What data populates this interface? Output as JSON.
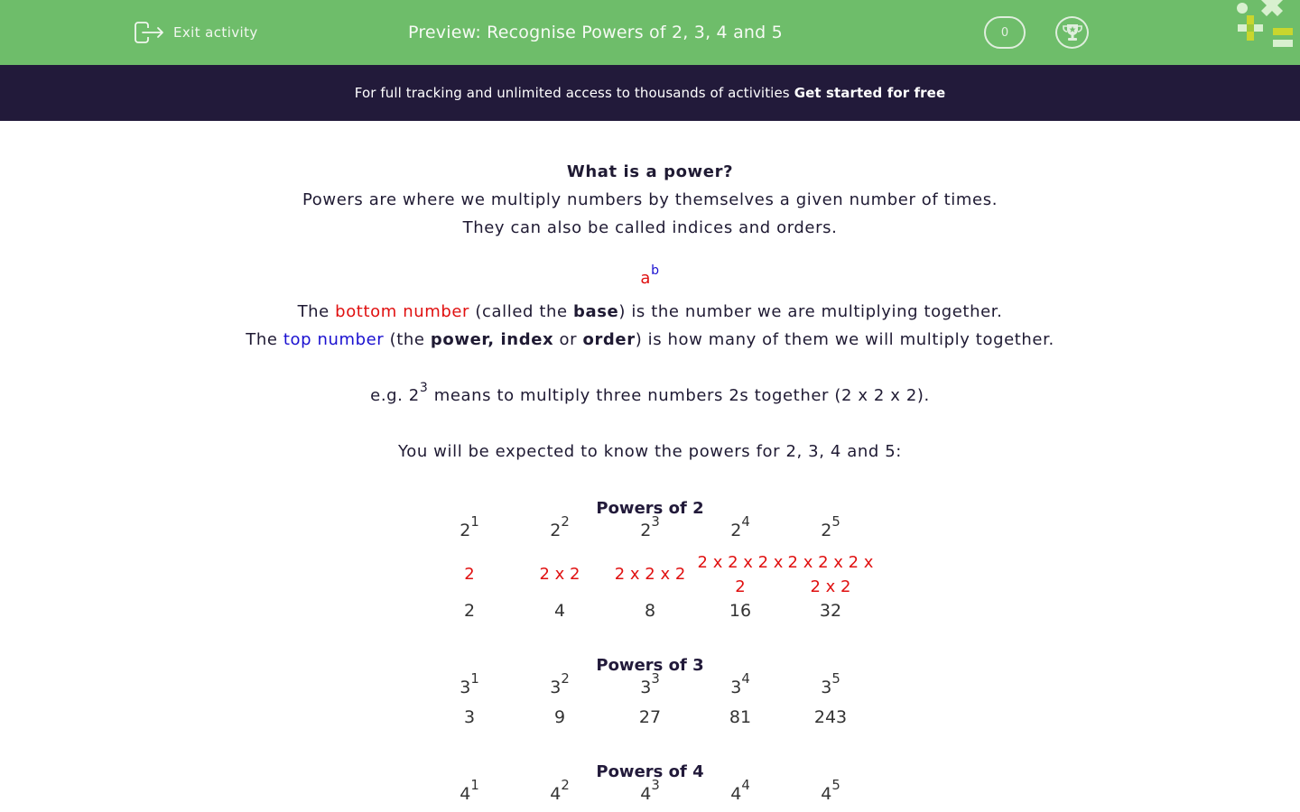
{
  "header": {
    "exit_label": "Exit activity",
    "title": "Preview: Recognise Powers of 2, 3, 4 and 5",
    "score": "0",
    "colors": {
      "bar": "#6ebd6a",
      "promo": "#221a3a"
    }
  },
  "promo": {
    "text": "For full tracking and unlimited access to thousands of activities",
    "cta": "Get started for free"
  },
  "intro": {
    "heading": "What is a power?",
    "line1": "Powers are where we multiply numbers by themselves a given number of times.",
    "line2": "They can also be called indices and orders."
  },
  "notation": {
    "base": "a",
    "exponent": "b",
    "base_line": {
      "pre": "The ",
      "highlight": "bottom number",
      "mid": " (called the ",
      "bold": "base",
      "post": ") is the number we are multiplying together."
    },
    "top_line": {
      "pre": "The ",
      "highlight": "top number",
      "mid1": " (the ",
      "bold1": "power, index",
      "mid2": " or ",
      "bold2": "order",
      "post": ") is how many of them we will multiply together."
    }
  },
  "example": {
    "pre": "e.g. 2",
    "sup": "3",
    "post": " means to multiply three numbers 2s together (2 x 2 x 2)."
  },
  "expectation": "You will be expected to know the powers for 2, 3, 4 and 5:",
  "tables": [
    {
      "title": "Powers of 2",
      "base": "2",
      "exponents": [
        "1",
        "2",
        "3",
        "4",
        "5"
      ],
      "expansions": [
        "2",
        "2 x 2",
        "2 x 2 x 2",
        "2 x 2 x 2 x 2",
        "2 x 2 x 2 x 2 x 2"
      ],
      "expansion_lines": [
        [
          "2"
        ],
        [
          "2 x 2"
        ],
        [
          "2 x 2 x 2"
        ],
        [
          "2 x 2 x 2 x",
          "2"
        ],
        [
          "2 x 2 x 2 x",
          "2 x 2"
        ]
      ],
      "results": [
        "2",
        "4",
        "8",
        "16",
        "32"
      ]
    },
    {
      "title": "Powers of 3",
      "base": "3",
      "exponents": [
        "1",
        "2",
        "3",
        "4",
        "5"
      ],
      "results": [
        "3",
        "9",
        "27",
        "81",
        "243"
      ]
    },
    {
      "title": "Powers of 4",
      "base": "4",
      "exponents": [
        "1",
        "2",
        "3",
        "4",
        "5"
      ]
    }
  ]
}
